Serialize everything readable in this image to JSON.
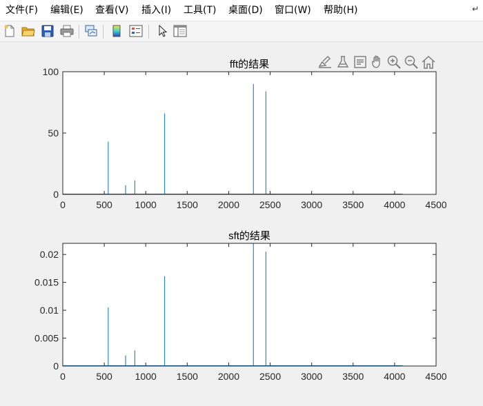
{
  "menubar": {
    "items": [
      {
        "id": "file",
        "label": "文件(F)"
      },
      {
        "id": "edit",
        "label": "编辑(E)"
      },
      {
        "id": "view",
        "label": "查看(V)"
      },
      {
        "id": "insert",
        "label": "插入(I)"
      },
      {
        "id": "tools",
        "label": "工具(T)"
      },
      {
        "id": "desktop",
        "label": "桌面(D)"
      },
      {
        "id": "window",
        "label": "窗口(W)"
      },
      {
        "id": "help",
        "label": "帮助(H)"
      }
    ]
  },
  "toolbar": {
    "icons": [
      "new-file-icon",
      "open-folder-icon",
      "save-icon",
      "print-icon",
      "link-plot-icon",
      "colorbar-icon",
      "legend-icon",
      "pointer-icon",
      "property-inspector-icon"
    ]
  },
  "axes_toolbar": {
    "icons": [
      "brush-icon",
      "data-tips-icon",
      "edit-plot-icon",
      "pan-icon",
      "zoom-in-icon",
      "zoom-out-icon",
      "home-icon"
    ]
  },
  "colors": {
    "series": "#0072bd",
    "axis": "#262626"
  },
  "chart_data": [
    {
      "type": "line",
      "title": "fft的结果",
      "xlim": [
        0,
        4500
      ],
      "ylim": [
        0,
        100
      ],
      "xticks": [
        0,
        500,
        1000,
        1500,
        2000,
        2500,
        3000,
        3500,
        4000,
        4500
      ],
      "yticks": [
        0,
        50,
        100
      ],
      "ytick_labels": [
        "0",
        "50",
        "100"
      ],
      "x_range": [
        1,
        4096
      ],
      "grid": false,
      "series": [
        {
          "x": [
            548,
            757,
            868,
            1228,
            2298,
            2448
          ],
          "values": [
            43,
            7.5,
            11.5,
            66,
            90,
            84
          ]
        }
      ]
    },
    {
      "type": "line",
      "title": "sft的结果",
      "xlim": [
        0,
        4500
      ],
      "ylim": [
        0,
        0.022
      ],
      "xticks": [
        0,
        500,
        1000,
        1500,
        2000,
        2500,
        3000,
        3500,
        4000,
        4500
      ],
      "yticks": [
        0,
        0.005,
        0.01,
        0.015,
        0.02
      ],
      "ytick_labels": [
        "0",
        "0.005",
        "0.01",
        "0.015",
        "0.02"
      ],
      "x_range": [
        1,
        4096
      ],
      "grid": false,
      "series": [
        {
          "x": [
            548,
            757,
            868,
            1228,
            2298,
            2448
          ],
          "values": [
            0.0105,
            0.0019,
            0.0028,
            0.0161,
            0.022,
            0.0205
          ]
        }
      ]
    }
  ]
}
